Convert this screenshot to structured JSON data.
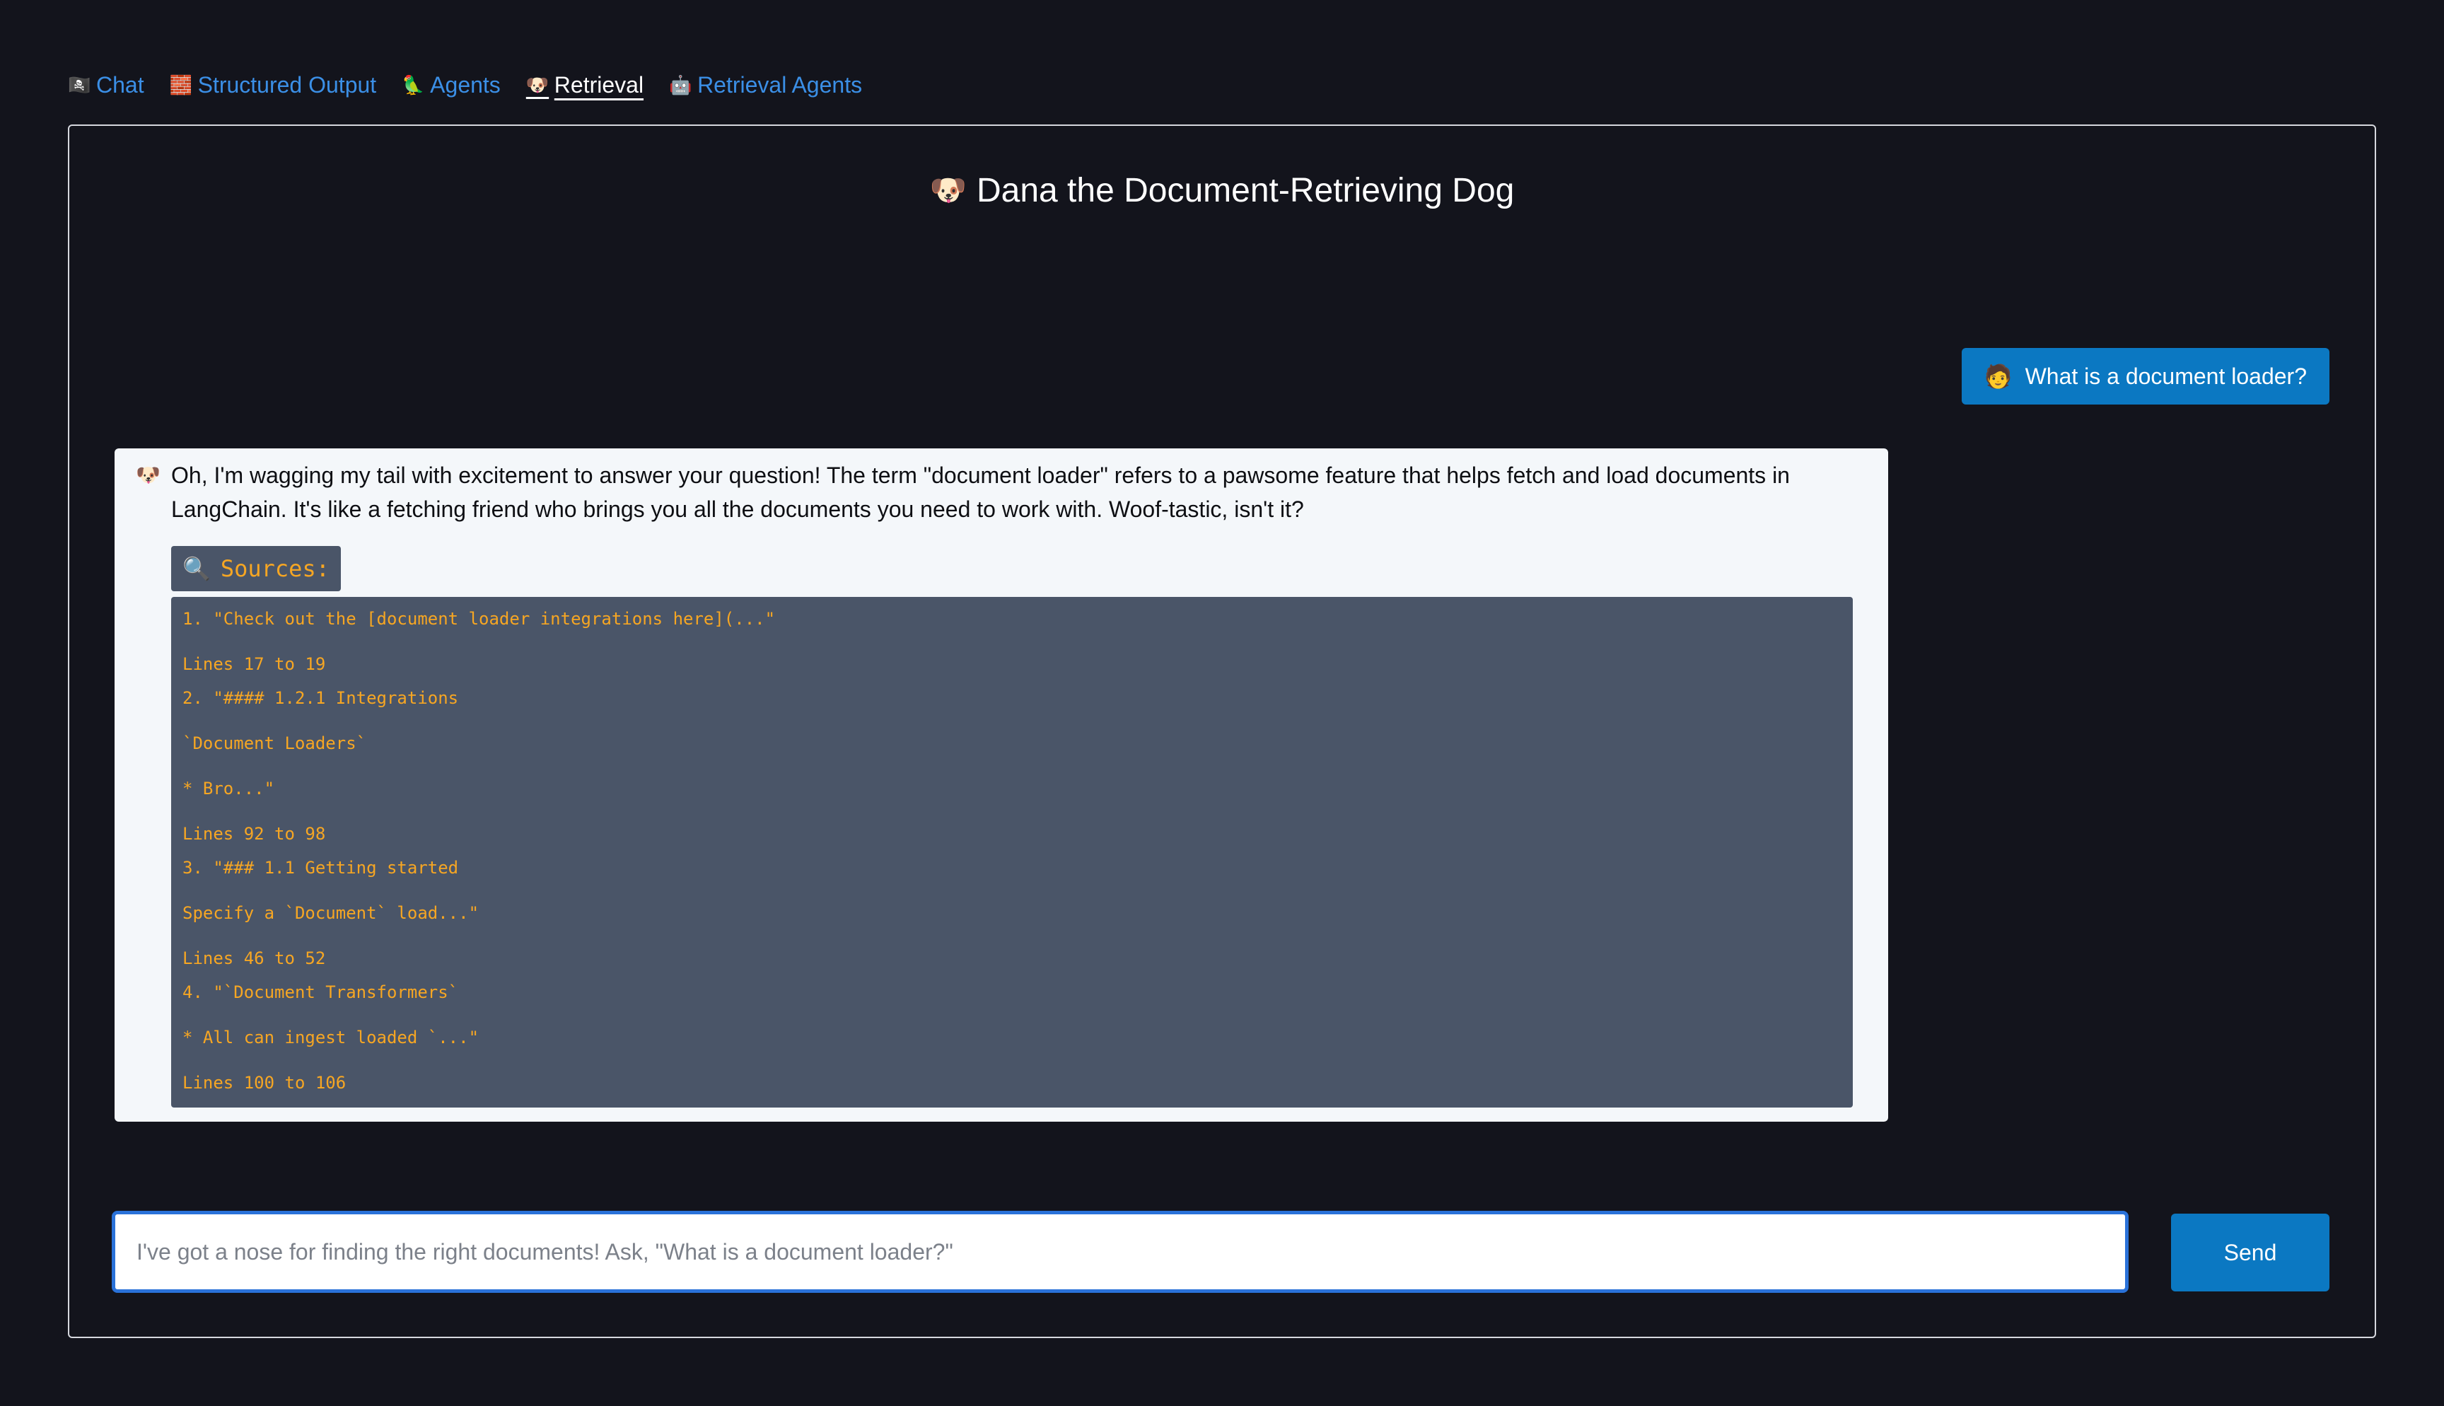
{
  "nav": {
    "items": [
      {
        "icon": "🏴‍☠️",
        "icon_name": "pirate-flag-icon",
        "label": "Chat",
        "active": false
      },
      {
        "icon": "🧱",
        "icon_name": "bricks-icon",
        "label": "Structured Output",
        "active": false
      },
      {
        "icon": "🦜",
        "icon_name": "parrot-icon",
        "label": "Agents",
        "active": false
      },
      {
        "icon": "🐶",
        "icon_name": "dog-icon",
        "label": "Retrieval",
        "active": true
      },
      {
        "icon": "🤖",
        "icon_name": "robot-icon",
        "label": "Retrieval Agents",
        "active": false
      }
    ]
  },
  "page": {
    "title_icon": "🐶",
    "title": "Dana the Document-Retrieving Dog"
  },
  "chat": {
    "user_message": {
      "icon": "🧑",
      "text": "What is a document loader?"
    },
    "ai_message": {
      "icon": "🐶",
      "text": "Oh, I'm wagging my tail with excitement to answer your question! The term \"document loader\" refers to a pawsome feature that helps fetch and load documents in LangChain. It's like a fetching friend who brings you all the documents you need to work with. Woof-tastic, isn't it?",
      "sources_icon": "🔍",
      "sources_label": "Sources:",
      "sources": [
        {
          "lines": [
            "1. \"Check out the [document loader integrations here](...\""
          ],
          "range": "Lines 17 to 19"
        },
        {
          "lines": [
            "2. \"#### 1.2.1 Integrations",
            "`Document Loaders`",
            "* Bro...\""
          ],
          "range": "Lines 92 to 98"
        },
        {
          "lines": [
            "3. \"### 1.1 Getting started",
            "Specify a `Document` load...\""
          ],
          "range": "Lines 46 to 52"
        },
        {
          "lines": [
            "4. \"`Document Transformers`",
            "* All can ingest loaded `...\""
          ],
          "range": "Lines 100 to 106"
        }
      ]
    }
  },
  "composer": {
    "placeholder": "I've got a nose for finding the right documents! Ask, \"What is a document loader?\"",
    "value": "",
    "send_label": "Send"
  },
  "colors": {
    "background": "#13141c",
    "link": "#3b8fe6",
    "accent": "#0b78c2",
    "source_text": "#f6a623",
    "source_bg": "#4a5568"
  }
}
